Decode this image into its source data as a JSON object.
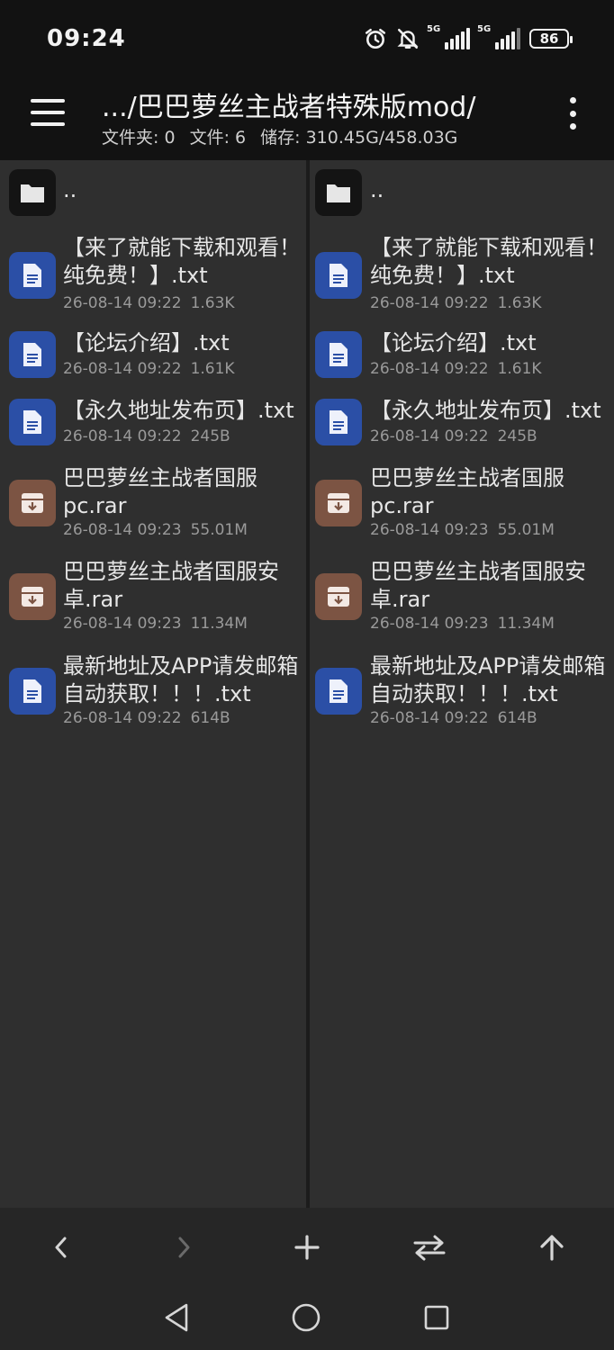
{
  "status_bar": {
    "time": "09:24",
    "network_1": "5G",
    "network_2": "5G",
    "battery": "86",
    "icons": [
      "alarm-icon",
      "mute-bell-icon",
      "signal-icon",
      "signal-icon",
      "battery-icon"
    ]
  },
  "toolbar": {
    "path": ".../巴巴萝丝主战者特殊版mod/",
    "folders": "文件夹: 0",
    "files": "文件: 6",
    "storage": "储存: 310.45G/458.03G",
    "icons": [
      "menu-icon",
      "more-vert-icon"
    ]
  },
  "panes": {
    "left": {
      "parent": "..",
      "files": [
        {
          "name": "【来了就能下载和观看！纯免费！】.txt",
          "date": "26-08-14 09:22",
          "size": "1.63K",
          "type": "txt"
        },
        {
          "name": "【论坛介绍】.txt",
          "date": "26-08-14 09:22",
          "size": "1.61K",
          "type": "txt"
        },
        {
          "name": "【永久地址发布页】.txt",
          "date": "26-08-14 09:22",
          "size": "245B",
          "type": "txt"
        },
        {
          "name": "巴巴萝丝主战者国服pc.rar",
          "date": "26-08-14 09:23",
          "size": "55.01M",
          "type": "rar"
        },
        {
          "name": "巴巴萝丝主战者国服安卓.rar",
          "date": "26-08-14 09:23",
          "size": "11.34M",
          "type": "rar"
        },
        {
          "name": "最新地址及APP请发邮箱自动获取！！！.txt",
          "date": "26-08-14 09:22",
          "size": "614B",
          "type": "txt"
        }
      ]
    },
    "right": {
      "parent": "..",
      "files": [
        {
          "name": "【来了就能下载和观看！纯免费！】.txt",
          "date": "26-08-14 09:22",
          "size": "1.63K",
          "type": "txt"
        },
        {
          "name": "【论坛介绍】.txt",
          "date": "26-08-14 09:22",
          "size": "1.61K",
          "type": "txt"
        },
        {
          "name": "【永久地址发布页】.txt",
          "date": "26-08-14 09:22",
          "size": "245B",
          "type": "txt"
        },
        {
          "name": "巴巴萝丝主战者国服pc.rar",
          "date": "26-08-14 09:23",
          "size": "55.01M",
          "type": "rar"
        },
        {
          "name": "巴巴萝丝主战者国服安卓.rar",
          "date": "26-08-14 09:23",
          "size": "11.34M",
          "type": "rar"
        },
        {
          "name": "最新地址及APP请发邮箱自动获取！！！.txt",
          "date": "26-08-14 09:22",
          "size": "614B",
          "type": "txt"
        }
      ]
    }
  },
  "bottom_bar": {
    "icons": [
      "back-arrow-icon",
      "forward-arrow-icon",
      "add-icon",
      "swap-icon",
      "up-arrow-icon"
    ]
  },
  "nav_bar": {
    "icons": [
      "nav-back-icon",
      "nav-home-icon",
      "nav-recents-icon"
    ]
  },
  "colors": {
    "background": "#121212",
    "pane": "#2f2f2f",
    "doc_icon": "#2b4fa6",
    "rar_icon": "#7c5443",
    "bar": "#262626"
  }
}
